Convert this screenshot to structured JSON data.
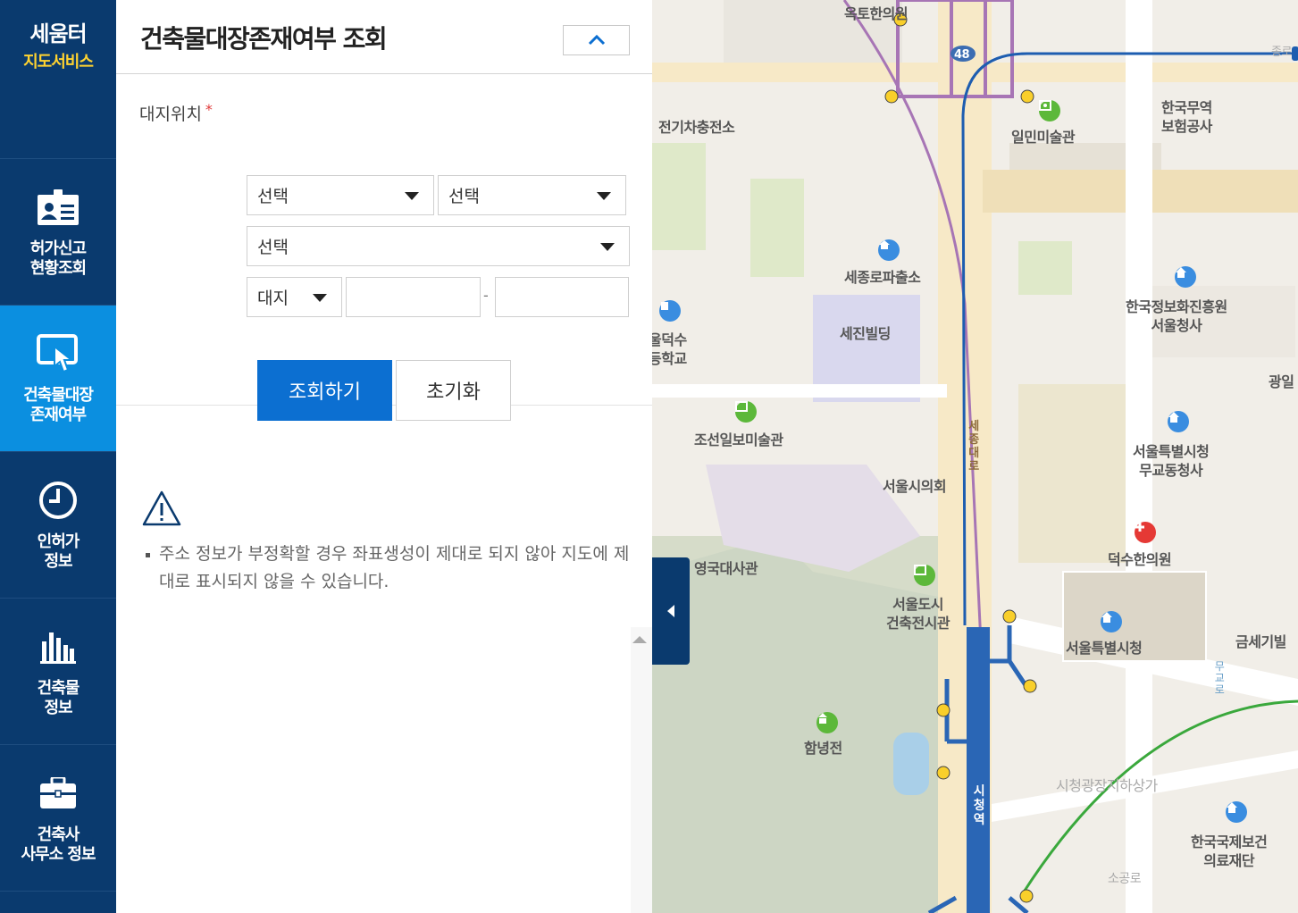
{
  "logo": {
    "line1": "세움터",
    "line2": "지도서비스"
  },
  "nav": [
    {
      "label": "허가신고\n현황조회",
      "icon": "id-card-icon",
      "active": false
    },
    {
      "label": "건축물대장\n존재여부",
      "icon": "touch-screen-icon",
      "active": true
    },
    {
      "label": "인허가\n정보",
      "icon": "clock-icon",
      "active": false
    },
    {
      "label": "건축물\n정보",
      "icon": "bar-chart-icon",
      "active": false
    },
    {
      "label": "건축사\n사무소 정보",
      "icon": "briefcase-icon",
      "active": false
    }
  ],
  "panel": {
    "title": "건축물대장존재여부 조회",
    "collapse_icon": "chevron-up-icon",
    "location_label": "대지위치",
    "required_mark": "*",
    "select1": "선택",
    "select2": "선택",
    "select3": "선택",
    "lot_type": "대지",
    "lot_main": "",
    "lot_sub": "",
    "separator": "-",
    "search_button": "조회하기",
    "reset_button": "초기화",
    "notice_icon": "warning-icon",
    "notice": "주소 정보가 부정확할 경우 좌표생성이 제대로 되지 않아 지도에 제대로 표시되지 않을 수 있습니다."
  },
  "map": {
    "labels": {
      "oktohan": "옥토한의원",
      "ev": "전기차충전소",
      "ilmin": "일민미술관",
      "kotra": "한국무역\n보험공사",
      "police": "세종로파출소",
      "sejin": "세진빌딩",
      "nia": "한국정보화진흥원\n서울청사",
      "deoksu_school": "울덕수\n등학교",
      "gwang": "광일",
      "chosun": "조선일보미술관",
      "council": "서울시의회",
      "mugyo": "서울특별시청\n무교동청사",
      "embassy": "영국대사관",
      "deoksu_clinic": "덕수한의원",
      "archi": "서울도시\n건축전시관",
      "cityhall": "서울특별시청",
      "geumsegi": "금세기빌",
      "hamnyeong": "함녕전",
      "underground": "시청광장지하상가",
      "ifhc": "한국국제보건\n의료재단",
      "sogong": "소공로",
      "sejongdaero": "세종대로",
      "sicheong_st": "시청역",
      "route48": "48",
      "mugyoro": "무교로",
      "jongno": "종로"
    }
  }
}
